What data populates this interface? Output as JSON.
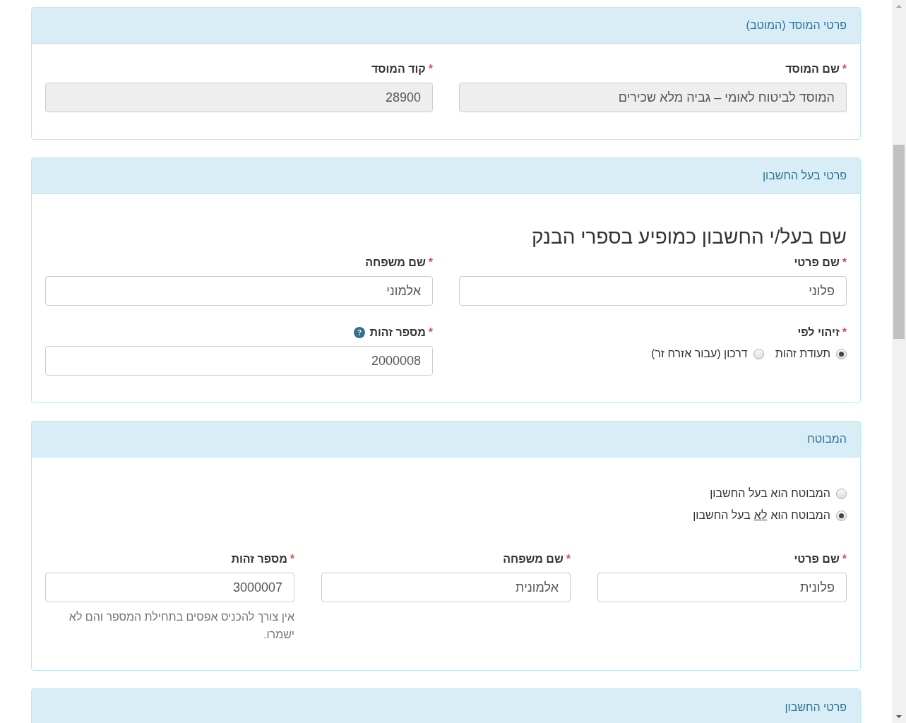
{
  "panels": [
    {
      "title": "פרטי המוסד (המוטב)",
      "rows": [
        [
          {
            "label": "שם המוסד",
            "marker": "*",
            "value": "המוסד לביטוח לאומי – גביה מלא שכירים",
            "disabled": true
          },
          {
            "label": "קוד המוסד",
            "marker": "*",
            "value": "28900",
            "disabled": true
          }
        ]
      ]
    },
    {
      "title": "פרטי בעל החשבון",
      "heading": "שם בעל/י החשבון כמופיע בספרי הבנק",
      "rows": [
        [
          {
            "label": "שם פרטי",
            "marker": "*",
            "value": "פלוני",
            "disabled": false
          },
          {
            "label": "שם משפחה",
            "marker": "*",
            "value": "אלמוני",
            "disabled": false
          }
        ],
        [
          {
            "kind": "radios",
            "label": "זיהוי לפי",
            "marker": "*",
            "options": [
              {
                "parts": [
                  {
                    "text": "תעודת זהות",
                    "underline": false
                  }
                ],
                "selected": true
              },
              {
                "parts": [
                  {
                    "text": "דרכון (עבור אזרח זר)",
                    "underline": false
                  }
                ],
                "selected": false
              }
            ]
          },
          {
            "label": "מספר זהות",
            "marker": "*",
            "help": true,
            "value": "2000008",
            "disabled": false
          }
        ]
      ]
    },
    {
      "title": "המבוטח",
      "options": [
        {
          "parts": [
            {
              "text": "המבוטח הוא בעל החשבון",
              "underline": false
            }
          ],
          "selected": false
        },
        {
          "parts": [
            {
              "text": "המבוטח הוא",
              "underline": false
            },
            {
              "text": "לא",
              "underline": true
            },
            {
              "text": "בעל החשבון",
              "underline": false
            }
          ],
          "selected": true
        }
      ],
      "rows": [
        [
          {
            "label": "שם פרטי",
            "marker": "*",
            "value": "פלונית",
            "disabled": false
          },
          {
            "label": "שם משפחה",
            "marker": "*",
            "value": "אלמונית",
            "disabled": false
          },
          {
            "label": "מספר זהות",
            "marker": "*",
            "value": "3000007",
            "disabled": false,
            "hint": "אין צורך להכניס אפסים בתחילת המספר והם לא ישמרו."
          }
        ]
      ]
    },
    {
      "title": "פרטי החשבון"
    }
  ]
}
